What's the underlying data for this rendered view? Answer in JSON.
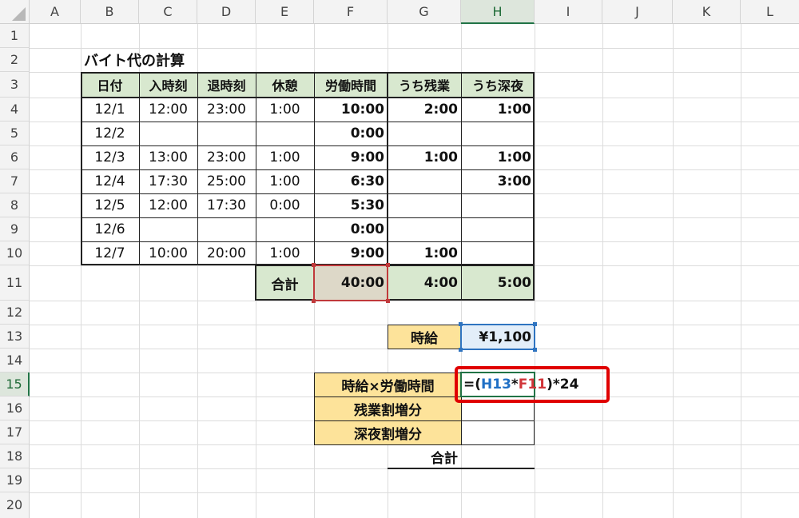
{
  "columns": [
    "A",
    "B",
    "C",
    "D",
    "E",
    "F",
    "G",
    "H",
    "I",
    "J",
    "K",
    "L"
  ],
  "rows": [
    "1",
    "2",
    "3",
    "4",
    "5",
    "6",
    "7",
    "8",
    "9",
    "10",
    "11",
    "12",
    "13",
    "14",
    "15",
    "16",
    "17",
    "18",
    "19",
    "20"
  ],
  "selected_column": "H",
  "selected_row": "15",
  "sheet_title": "バイト代の計算",
  "table": {
    "headers": [
      "日付",
      "入時刻",
      "退時刻",
      "休憩",
      "労働時間",
      "うち残業",
      "うち深夜"
    ],
    "rows": [
      [
        "12/1",
        "12:00",
        "23:00",
        "1:00",
        "10:00",
        "2:00",
        "1:00"
      ],
      [
        "12/2",
        "",
        "",
        "",
        "0:00",
        "",
        ""
      ],
      [
        "12/3",
        "13:00",
        "23:00",
        "1:00",
        "9:00",
        "1:00",
        "1:00"
      ],
      [
        "12/4",
        "17:30",
        "25:00",
        "1:00",
        "6:30",
        "",
        "3:00"
      ],
      [
        "12/5",
        "12:00",
        "17:30",
        "0:00",
        "5:30",
        "",
        ""
      ],
      [
        "12/6",
        "",
        "",
        "",
        "0:00",
        "",
        ""
      ],
      [
        "12/7",
        "10:00",
        "20:00",
        "1:00",
        "9:00",
        "1:00",
        ""
      ]
    ],
    "total_label": "合計",
    "totals": [
      "40:00",
      "4:00",
      "5:00"
    ]
  },
  "wage": {
    "label": "時給",
    "value": "¥1,100"
  },
  "calc": {
    "labels": [
      "時給×労働時間",
      "残業割増分",
      "深夜割増分"
    ],
    "total_label": "合計"
  },
  "formula": {
    "eq": "=(",
    "ref1": "H13",
    "op": "*",
    "ref2": "F11",
    "tail": ")*24"
  },
  "colors": {
    "table_header_fill": "#d8e8cf",
    "label_fill": "#fde39a",
    "selection_green": "#217346",
    "highlight_red": "#e00000",
    "ref_blue": "#1f6fc5",
    "ref_red": "#d13438"
  }
}
